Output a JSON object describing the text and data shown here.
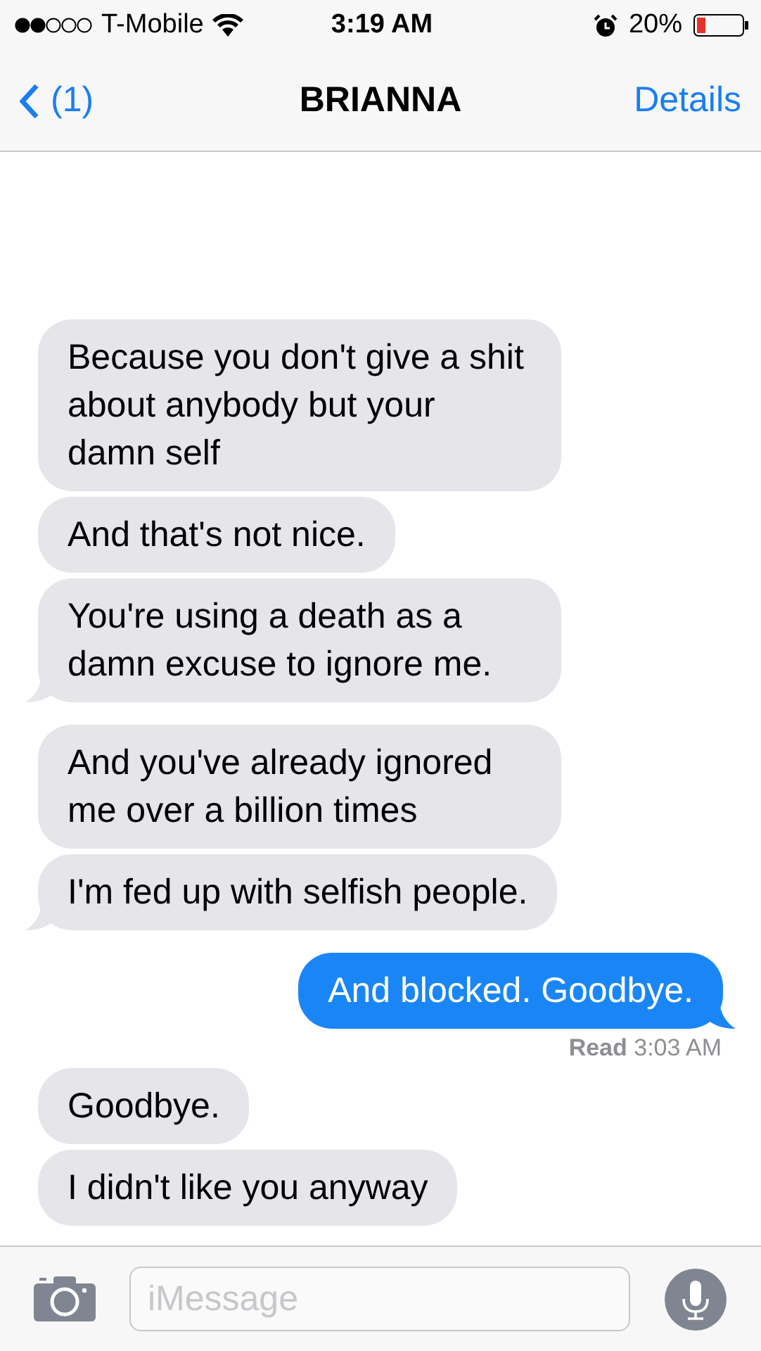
{
  "status_bar": {
    "carrier": "T-Mobile",
    "time": "3:19 AM",
    "battery": "20%"
  },
  "nav": {
    "back": "(1)",
    "title": "BRIANNA",
    "action": "Details"
  },
  "messages": [
    {
      "kind": "received",
      "text": "Because you don't give a shit about anybody but your damn self",
      "tail": false
    },
    {
      "kind": "received",
      "text": "And that's not nice.",
      "tail": false
    },
    {
      "kind": "received",
      "text": "You're using a death as a damn excuse to ignore me.",
      "tail": true
    },
    {
      "kind": "received",
      "text": "And you've already ignored me over a billion times",
      "tail": false
    },
    {
      "kind": "received",
      "text": "I'm fed up with selfish people.",
      "tail": true
    },
    {
      "kind": "sent",
      "text": "And blocked. Goodbye.",
      "tail": true
    },
    {
      "kind": "receipt",
      "text": "**Read** 3:03 AM"
    },
    {
      "kind": "received",
      "text": "Goodbye.",
      "tail": false
    },
    {
      "kind": "received",
      "text": "I didn't like you anyway",
      "tail": false
    }
  ],
  "input": {
    "placeholder": "iMessage"
  }
}
